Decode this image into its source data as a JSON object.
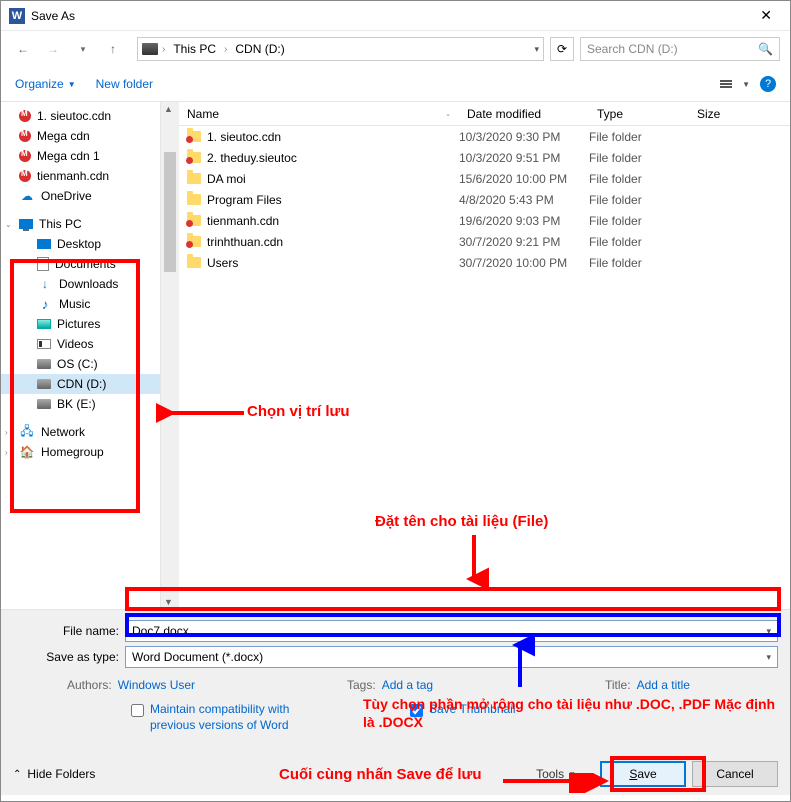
{
  "title": "Save As",
  "breadcrumb": {
    "root": "This PC",
    "drive": "CDN (D:)"
  },
  "search_placeholder": "Search CDN (D:)",
  "toolbar": {
    "organize": "Organize",
    "newfolder": "New folder"
  },
  "columns": {
    "name": "Name",
    "date": "Date modified",
    "type": "Type",
    "size": "Size"
  },
  "sidebar_top": [
    {
      "label": "1. sieutoc.cdn",
      "icon": "mega"
    },
    {
      "label": "Mega cdn",
      "icon": "mega"
    },
    {
      "label": "Mega cdn 1",
      "icon": "mega"
    },
    {
      "label": "tienmanh.cdn",
      "icon": "mega"
    },
    {
      "label": "OneDrive",
      "icon": "cloud"
    }
  ],
  "thispc_label": "This PC",
  "thispc_children": [
    {
      "label": "Desktop",
      "icon": "desktop"
    },
    {
      "label": "Documents",
      "icon": "doc"
    },
    {
      "label": "Downloads",
      "icon": "down"
    },
    {
      "label": "Music",
      "icon": "music"
    },
    {
      "label": "Pictures",
      "icon": "pic"
    },
    {
      "label": "Videos",
      "icon": "video"
    },
    {
      "label": "OS (C:)",
      "icon": "disk"
    },
    {
      "label": "CDN (D:)",
      "icon": "disk",
      "selected": true
    },
    {
      "label": "BK (E:)",
      "icon": "disk"
    }
  ],
  "sidebar_bottom": [
    {
      "label": "Network",
      "icon": "net"
    },
    {
      "label": "Homegroup",
      "icon": "home"
    }
  ],
  "files": [
    {
      "name": "1. sieutoc.cdn",
      "date": "10/3/2020 9:30 PM",
      "type": "File folder",
      "icon": "folder red"
    },
    {
      "name": "2. theduy.sieutoc",
      "date": "10/3/2020 9:51 PM",
      "type": "File folder",
      "icon": "folder red"
    },
    {
      "name": "DA moi",
      "date": "15/6/2020 10:00 PM",
      "type": "File folder",
      "icon": "folder"
    },
    {
      "name": "Program Files",
      "date": "4/8/2020 5:43 PM",
      "type": "File folder",
      "icon": "folder"
    },
    {
      "name": "tienmanh.cdn",
      "date": "19/6/2020 9:03 PM",
      "type": "File folder",
      "icon": "folder red"
    },
    {
      "name": "trinhthuan.cdn",
      "date": "30/7/2020 9:21 PM",
      "type": "File folder",
      "icon": "folder red"
    },
    {
      "name": "Users",
      "date": "30/7/2020 10:00 PM",
      "type": "File folder",
      "icon": "folder"
    }
  ],
  "form": {
    "filename_label": "File name:",
    "filename_value": "Doc7.docx",
    "savetype_label": "Save as type:",
    "savetype_value": "Word Document (*.docx)",
    "authors_label": "Authors:",
    "authors_value": "Windows User",
    "tags_label": "Tags:",
    "tags_value": "Add a tag",
    "title_label": "Title:",
    "title_value": "Add a title",
    "maintain_label": "Maintain compatibility with previous versions of Word",
    "thumb_label": "Save Thumbnail",
    "hidefolders": "Hide Folders",
    "tools": "Tools",
    "save": "Save",
    "cancel": "Cancel"
  },
  "annotations": {
    "a1": "Chọn vị trí lưu",
    "a2": "Đặt tên cho tài liệu (File)",
    "a3": "Tùy chọn phần mở rộng cho tài liệu như .DOC, .PDF Mặc định là .DOCX",
    "a4": "Cuối cùng nhấn Save để lưu"
  }
}
